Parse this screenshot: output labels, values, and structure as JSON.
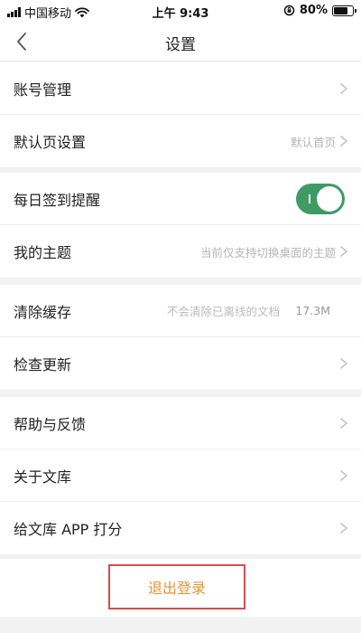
{
  "status_bar": {
    "carrier": "中国移动",
    "time": "上午 9:43",
    "battery": "80%",
    "battery_level": 0.8
  },
  "nav": {
    "title": "设置",
    "back_icon": "chevron-left-icon"
  },
  "groups": [
    {
      "items": [
        {
          "label": "账号管理"
        },
        {
          "label": "默认页设置",
          "value": "默认首页"
        }
      ]
    },
    {
      "items": [
        {
          "label": "每日签到提醒",
          "toggle_on": true
        },
        {
          "label": "我的主题",
          "value": "当前仅支持切换桌面的主题"
        }
      ]
    },
    {
      "items": [
        {
          "label": "清除缓存",
          "hint": "不会清除已离线的文档",
          "size": "17.3M"
        },
        {
          "label": "检查更新"
        }
      ]
    },
    {
      "items": [
        {
          "label": "帮助与反馈"
        },
        {
          "label": "关于文库"
        },
        {
          "label": "给文库 APP 打分"
        }
      ]
    }
  ],
  "logout": {
    "label": "退出登录"
  },
  "colors": {
    "toggle_on": "#3f9a64",
    "logout_text": "#e8933a",
    "logout_border": "#d94b4b"
  }
}
